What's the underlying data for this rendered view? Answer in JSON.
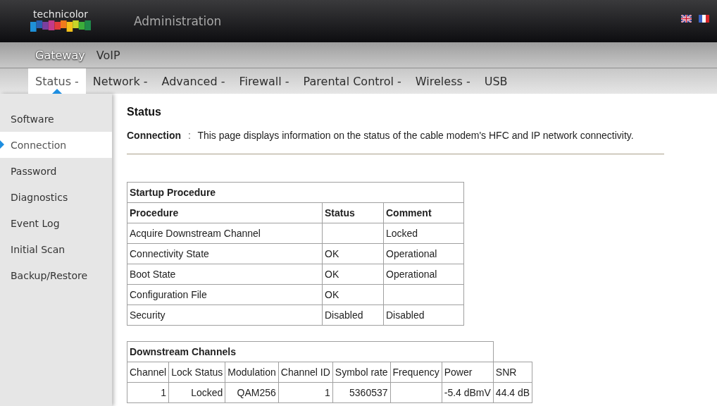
{
  "header": {
    "brand": "technicolor",
    "title": "Administration"
  },
  "main_tabs": [
    {
      "label": "Gateway",
      "selected": true
    },
    {
      "label": "VoIP",
      "selected": false
    }
  ],
  "sub_tabs": [
    {
      "label": "Status -",
      "selected": true
    },
    {
      "label": "Network -",
      "selected": false
    },
    {
      "label": "Advanced -",
      "selected": false
    },
    {
      "label": "Firewall -",
      "selected": false
    },
    {
      "label": "Parental Control -",
      "selected": false
    },
    {
      "label": "Wireless -",
      "selected": false
    },
    {
      "label": "USB",
      "selected": false
    }
  ],
  "sidebar": {
    "items": [
      {
        "label": "Software",
        "selected": false
      },
      {
        "label": "Connection",
        "selected": true
      },
      {
        "label": "Password",
        "selected": false
      },
      {
        "label": "Diagnostics",
        "selected": false
      },
      {
        "label": "Event Log",
        "selected": false
      },
      {
        "label": "Initial Scan",
        "selected": false
      },
      {
        "label": "Backup/Restore",
        "selected": false
      }
    ]
  },
  "content": {
    "heading": "Status",
    "intro_label": "Connection",
    "intro_separator": ":",
    "intro_text": "This page displays information on the status of the cable modem's HFC and IP network connectivity.",
    "startup_table": {
      "title": "Startup Procedure",
      "columns": [
        "Procedure",
        "Status",
        "Comment"
      ],
      "rows": [
        [
          "Acquire Downstream Channel",
          "",
          "Locked"
        ],
        [
          "Connectivity State",
          "OK",
          "Operational"
        ],
        [
          "Boot State",
          "OK",
          "Operational"
        ],
        [
          "Configuration File",
          "OK",
          ""
        ],
        [
          "Security",
          "Disabled",
          "Disabled"
        ]
      ]
    },
    "downstream_table": {
      "title": "Downstream Channels",
      "columns": [
        "Channel",
        "Lock Status",
        "Modulation",
        "Channel ID",
        "Symbol rate",
        "Frequency",
        "Power",
        "SNR"
      ],
      "rows": [
        [
          "1",
          "Locked",
          "QAM256",
          "1",
          "5360537",
          "",
          "-5.4 dBmV",
          "44.4 dB"
        ]
      ]
    }
  }
}
